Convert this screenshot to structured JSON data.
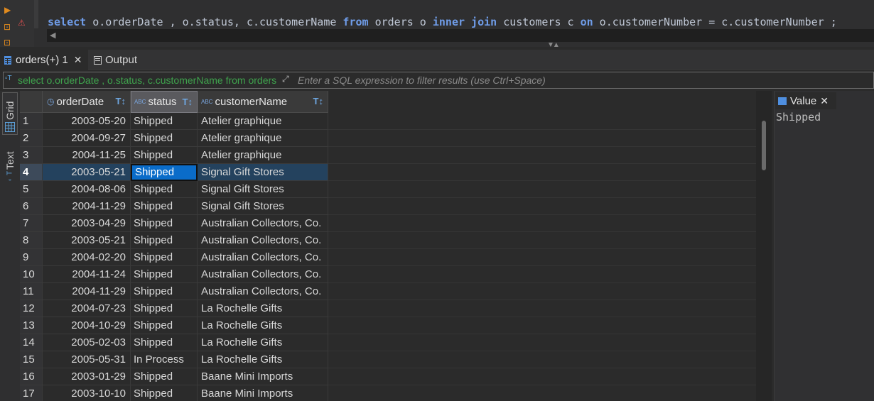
{
  "editor": {
    "sql": {
      "t1": "select",
      "t2": " o.orderDate , o.status, c.customerName ",
      "t3": "from",
      "t4": " orders o ",
      "t5": "inner",
      "t6": " ",
      "t7": "join",
      "t8": " customers c ",
      "t9": "on",
      "t10": " o.customerNumber = c.customerNumber ;"
    }
  },
  "tabs": [
    {
      "label": "orders(+) 1",
      "icon": "table-icon",
      "active": true
    },
    {
      "label": "Output",
      "icon": "output-icon",
      "active": false
    }
  ],
  "filter": {
    "query": "select o.orderDate , o.status, c.customerName from orders o inner join customers c on o.customerNumber = c.customerNumber",
    "placeholder": "Enter a SQL expression to filter results (use Ctrl+Space)"
  },
  "side_tabs": {
    "grid": "Grid",
    "text": "Text"
  },
  "grid": {
    "columns": [
      {
        "name": "orderDate",
        "icon": "clock-icon"
      },
      {
        "name": "status",
        "icon": "abc-icon"
      },
      {
        "name": "customerName",
        "icon": "abc-icon"
      }
    ],
    "rows": [
      {
        "n": "1",
        "orderDate": "2003-05-20",
        "status": "Shipped",
        "customerName": "Atelier graphique"
      },
      {
        "n": "2",
        "orderDate": "2004-09-27",
        "status": "Shipped",
        "customerName": "Atelier graphique"
      },
      {
        "n": "3",
        "orderDate": "2004-11-25",
        "status": "Shipped",
        "customerName": "Atelier graphique"
      },
      {
        "n": "4",
        "orderDate": "2003-05-21",
        "status": "Shipped",
        "customerName": "Signal Gift Stores"
      },
      {
        "n": "5",
        "orderDate": "2004-08-06",
        "status": "Shipped",
        "customerName": "Signal Gift Stores"
      },
      {
        "n": "6",
        "orderDate": "2004-11-29",
        "status": "Shipped",
        "customerName": "Signal Gift Stores"
      },
      {
        "n": "7",
        "orderDate": "2003-04-29",
        "status": "Shipped",
        "customerName": "Australian Collectors, Co."
      },
      {
        "n": "8",
        "orderDate": "2003-05-21",
        "status": "Shipped",
        "customerName": "Australian Collectors, Co."
      },
      {
        "n": "9",
        "orderDate": "2004-02-20",
        "status": "Shipped",
        "customerName": "Australian Collectors, Co."
      },
      {
        "n": "10",
        "orderDate": "2004-11-24",
        "status": "Shipped",
        "customerName": "Australian Collectors, Co."
      },
      {
        "n": "11",
        "orderDate": "2004-11-29",
        "status": "Shipped",
        "customerName": "Australian Collectors, Co."
      },
      {
        "n": "12",
        "orderDate": "2004-07-23",
        "status": "Shipped",
        "customerName": "La Rochelle Gifts"
      },
      {
        "n": "13",
        "orderDate": "2004-10-29",
        "status": "Shipped",
        "customerName": "La Rochelle Gifts"
      },
      {
        "n": "14",
        "orderDate": "2005-02-03",
        "status": "Shipped",
        "customerName": "La Rochelle Gifts"
      },
      {
        "n": "15",
        "orderDate": "2005-05-31",
        "status": "In Process",
        "customerName": "La Rochelle Gifts"
      },
      {
        "n": "16",
        "orderDate": "2003-01-29",
        "status": "Shipped",
        "customerName": "Baane Mini Imports"
      },
      {
        "n": "17",
        "orderDate": "2003-10-10",
        "status": "Shipped",
        "customerName": "Baane Mini Imports"
      }
    ],
    "selected_row": 4
  },
  "value_panel": {
    "tab_label": "Value",
    "value": "Shipped"
  },
  "colors": {
    "keyword": "#6f9ce8",
    "selection": "#0a6cc9",
    "filter_text": "#3fa34d"
  }
}
